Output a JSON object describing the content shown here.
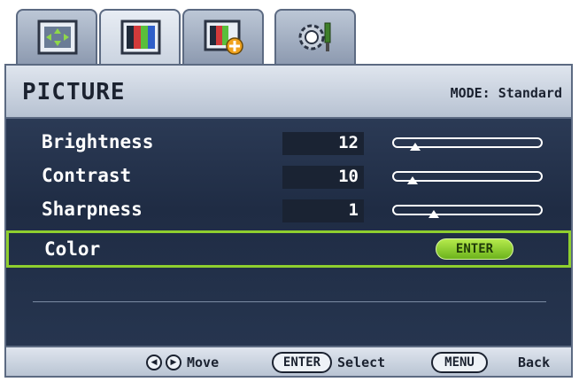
{
  "tabs": [
    {
      "icon": "display-position-icon",
      "active": false
    },
    {
      "icon": "picture-icon",
      "active": true
    },
    {
      "icon": "picture-advanced-icon",
      "active": false
    },
    {
      "icon": "system-settings-icon",
      "active": false
    }
  ],
  "header": {
    "title": "PICTURE",
    "mode": "MODE: Standard"
  },
  "settings": [
    {
      "label": "Brightness",
      "value": "12",
      "level": 0.12
    },
    {
      "label": "Contrast",
      "value": "10",
      "level": 0.1
    },
    {
      "label": "Sharpness",
      "value": "1",
      "level": 0.25
    }
  ],
  "color_row": {
    "label": "Color",
    "button": "ENTER",
    "highlight": "#8fcf2e"
  },
  "footer": {
    "move": "Move",
    "enter_key": "ENTER",
    "select": "Select",
    "menu_key": "MENU",
    "back": "Back"
  },
  "colors": {
    "panel": "#22304a",
    "header": "#c9d2df",
    "accent_green": "#8fcf2e"
  }
}
